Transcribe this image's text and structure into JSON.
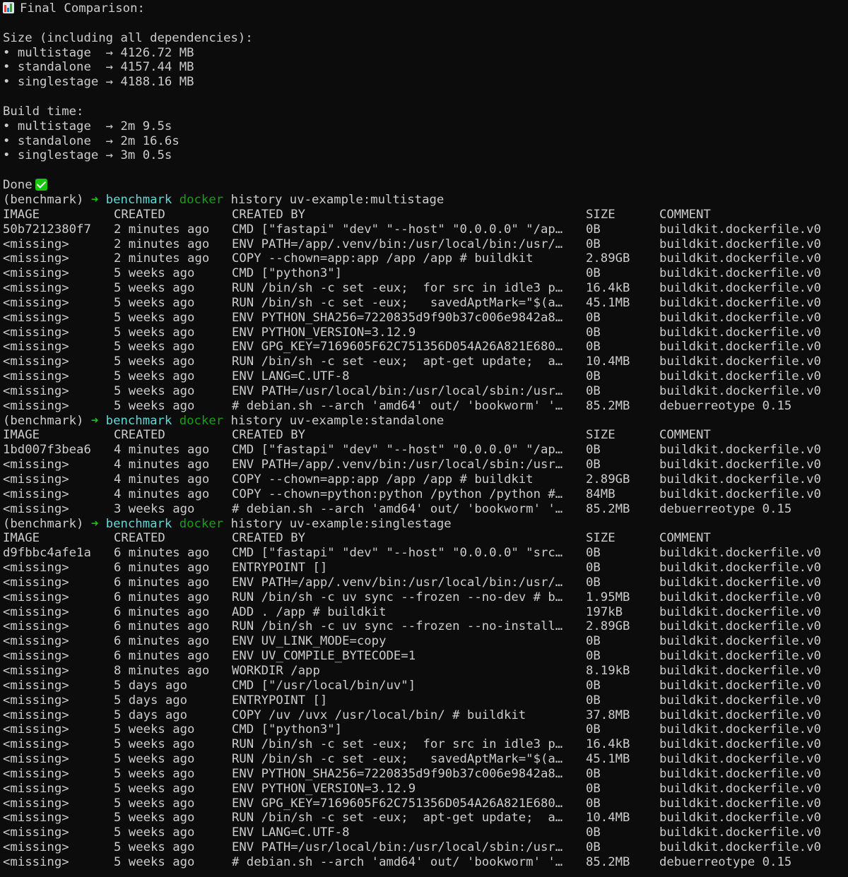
{
  "summary": {
    "title": "Final Comparison:",
    "size_heading": "Size (including all dependencies):",
    "size_items": [
      {
        "bullet": "•",
        "name": "multistage ",
        "arrow": "→",
        "value": "4126.72 MB"
      },
      {
        "bullet": "•",
        "name": "standalone ",
        "arrow": "→",
        "value": "4157.44 MB"
      },
      {
        "bullet": "•",
        "name": "singlestage",
        "arrow": "→",
        "value": "4188.16 MB"
      }
    ],
    "build_heading": "Build time:",
    "build_items": [
      {
        "bullet": "•",
        "name": "multistage ",
        "arrow": "→",
        "value": "2m 9.5s"
      },
      {
        "bullet": "•",
        "name": "standalone ",
        "arrow": "→",
        "value": "2m 16.6s"
      },
      {
        "bullet": "•",
        "name": "singlestage",
        "arrow": "→",
        "value": "3m 0.5s"
      }
    ],
    "done_label": "Done"
  },
  "prompt": {
    "env": "(benchmark)",
    "arrow": "➜",
    "dir": "benchmark",
    "cmd": "docker"
  },
  "headers": {
    "image": "IMAGE",
    "created": "CREATED",
    "created_by": "CREATED BY",
    "size": "SIZE",
    "comment": "COMMENT"
  },
  "histories": [
    {
      "args": "history uv-example:multistage",
      "rows": [
        {
          "image": "50b7212380f7",
          "created": "2 minutes ago",
          "by": "CMD [\"fastapi\" \"dev\" \"--host\" \"0.0.0.0\" \"/ap…",
          "size": "0B",
          "comment": "buildkit.dockerfile.v0"
        },
        {
          "image": "<missing>",
          "created": "2 minutes ago",
          "by": "ENV PATH=/app/.venv/bin:/usr/local/bin:/usr/…",
          "size": "0B",
          "comment": "buildkit.dockerfile.v0"
        },
        {
          "image": "<missing>",
          "created": "2 minutes ago",
          "by": "COPY --chown=app:app /app /app # buildkit",
          "size": "2.89GB",
          "comment": "buildkit.dockerfile.v0"
        },
        {
          "image": "<missing>",
          "created": "5 weeks ago",
          "by": "CMD [\"python3\"]",
          "size": "0B",
          "comment": "buildkit.dockerfile.v0"
        },
        {
          "image": "<missing>",
          "created": "5 weeks ago",
          "by": "RUN /bin/sh -c set -eux;  for src in idle3 p…",
          "size": "16.4kB",
          "comment": "buildkit.dockerfile.v0"
        },
        {
          "image": "<missing>",
          "created": "5 weeks ago",
          "by": "RUN /bin/sh -c set -eux;   savedAptMark=\"$(a…",
          "size": "45.1MB",
          "comment": "buildkit.dockerfile.v0"
        },
        {
          "image": "<missing>",
          "created": "5 weeks ago",
          "by": "ENV PYTHON_SHA256=7220835d9f90b37c006e9842a8…",
          "size": "0B",
          "comment": "buildkit.dockerfile.v0"
        },
        {
          "image": "<missing>",
          "created": "5 weeks ago",
          "by": "ENV PYTHON_VERSION=3.12.9",
          "size": "0B",
          "comment": "buildkit.dockerfile.v0"
        },
        {
          "image": "<missing>",
          "created": "5 weeks ago",
          "by": "ENV GPG_KEY=7169605F62C751356D054A26A821E680…",
          "size": "0B",
          "comment": "buildkit.dockerfile.v0"
        },
        {
          "image": "<missing>",
          "created": "5 weeks ago",
          "by": "RUN /bin/sh -c set -eux;  apt-get update;  a…",
          "size": "10.4MB",
          "comment": "buildkit.dockerfile.v0"
        },
        {
          "image": "<missing>",
          "created": "5 weeks ago",
          "by": "ENV LANG=C.UTF-8",
          "size": "0B",
          "comment": "buildkit.dockerfile.v0"
        },
        {
          "image": "<missing>",
          "created": "5 weeks ago",
          "by": "ENV PATH=/usr/local/bin:/usr/local/sbin:/usr…",
          "size": "0B",
          "comment": "buildkit.dockerfile.v0"
        },
        {
          "image": "<missing>",
          "created": "5 weeks ago",
          "by": "# debian.sh --arch 'amd64' out/ 'bookworm' '…",
          "size": "85.2MB",
          "comment": "debuerreotype 0.15"
        }
      ]
    },
    {
      "args": "history uv-example:standalone",
      "rows": [
        {
          "image": "1bd007f3bea6",
          "created": "4 minutes ago",
          "by": "CMD [\"fastapi\" \"dev\" \"--host\" \"0.0.0.0\" \"/ap…",
          "size": "0B",
          "comment": "buildkit.dockerfile.v0"
        },
        {
          "image": "<missing>",
          "created": "4 minutes ago",
          "by": "ENV PATH=/app/.venv/bin:/usr/local/sbin:/usr…",
          "size": "0B",
          "comment": "buildkit.dockerfile.v0"
        },
        {
          "image": "<missing>",
          "created": "4 minutes ago",
          "by": "COPY --chown=app:app /app /app # buildkit",
          "size": "2.89GB",
          "comment": "buildkit.dockerfile.v0"
        },
        {
          "image": "<missing>",
          "created": "4 minutes ago",
          "by": "COPY --chown=python:python /python /python #…",
          "size": "84MB",
          "comment": "buildkit.dockerfile.v0"
        },
        {
          "image": "<missing>",
          "created": "3 weeks ago",
          "by": "# debian.sh --arch 'amd64' out/ 'bookworm' '…",
          "size": "85.2MB",
          "comment": "debuerreotype 0.15"
        }
      ]
    },
    {
      "args": "history uv-example:singlestage",
      "rows": [
        {
          "image": "d9fbbc4afe1a",
          "created": "6 minutes ago",
          "by": "CMD [\"fastapi\" \"dev\" \"--host\" \"0.0.0.0\" \"src…",
          "size": "0B",
          "comment": "buildkit.dockerfile.v0"
        },
        {
          "image": "<missing>",
          "created": "6 minutes ago",
          "by": "ENTRYPOINT []",
          "size": "0B",
          "comment": "buildkit.dockerfile.v0"
        },
        {
          "image": "<missing>",
          "created": "6 minutes ago",
          "by": "ENV PATH=/app/.venv/bin:/usr/local/bin:/usr/…",
          "size": "0B",
          "comment": "buildkit.dockerfile.v0"
        },
        {
          "image": "<missing>",
          "created": "6 minutes ago",
          "by": "RUN /bin/sh -c uv sync --frozen --no-dev # b…",
          "size": "1.95MB",
          "comment": "buildkit.dockerfile.v0"
        },
        {
          "image": "<missing>",
          "created": "6 minutes ago",
          "by": "ADD . /app # buildkit",
          "size": "197kB",
          "comment": "buildkit.dockerfile.v0"
        },
        {
          "image": "<missing>",
          "created": "6 minutes ago",
          "by": "RUN /bin/sh -c uv sync --frozen --no-install…",
          "size": "2.89GB",
          "comment": "buildkit.dockerfile.v0"
        },
        {
          "image": "<missing>",
          "created": "6 minutes ago",
          "by": "ENV UV_LINK_MODE=copy",
          "size": "0B",
          "comment": "buildkit.dockerfile.v0"
        },
        {
          "image": "<missing>",
          "created": "6 minutes ago",
          "by": "ENV UV_COMPILE_BYTECODE=1",
          "size": "0B",
          "comment": "buildkit.dockerfile.v0"
        },
        {
          "image": "<missing>",
          "created": "8 minutes ago",
          "by": "WORKDIR /app",
          "size": "8.19kB",
          "comment": "buildkit.dockerfile.v0"
        },
        {
          "image": "<missing>",
          "created": "5 days ago",
          "by": "CMD [\"/usr/local/bin/uv\"]",
          "size": "0B",
          "comment": "buildkit.dockerfile.v0"
        },
        {
          "image": "<missing>",
          "created": "5 days ago",
          "by": "ENTRYPOINT []",
          "size": "0B",
          "comment": "buildkit.dockerfile.v0"
        },
        {
          "image": "<missing>",
          "created": "5 days ago",
          "by": "COPY /uv /uvx /usr/local/bin/ # buildkit",
          "size": "37.8MB",
          "comment": "buildkit.dockerfile.v0"
        },
        {
          "image": "<missing>",
          "created": "5 weeks ago",
          "by": "CMD [\"python3\"]",
          "size": "0B",
          "comment": "buildkit.dockerfile.v0"
        },
        {
          "image": "<missing>",
          "created": "5 weeks ago",
          "by": "RUN /bin/sh -c set -eux;  for src in idle3 p…",
          "size": "16.4kB",
          "comment": "buildkit.dockerfile.v0"
        },
        {
          "image": "<missing>",
          "created": "5 weeks ago",
          "by": "RUN /bin/sh -c set -eux;   savedAptMark=\"$(a…",
          "size": "45.1MB",
          "comment": "buildkit.dockerfile.v0"
        },
        {
          "image": "<missing>",
          "created": "5 weeks ago",
          "by": "ENV PYTHON_SHA256=7220835d9f90b37c006e9842a8…",
          "size": "0B",
          "comment": "buildkit.dockerfile.v0"
        },
        {
          "image": "<missing>",
          "created": "5 weeks ago",
          "by": "ENV PYTHON_VERSION=3.12.9",
          "size": "0B",
          "comment": "buildkit.dockerfile.v0"
        },
        {
          "image": "<missing>",
          "created": "5 weeks ago",
          "by": "ENV GPG_KEY=7169605F62C751356D054A26A821E680…",
          "size": "0B",
          "comment": "buildkit.dockerfile.v0"
        },
        {
          "image": "<missing>",
          "created": "5 weeks ago",
          "by": "RUN /bin/sh -c set -eux;  apt-get update;  a…",
          "size": "10.4MB",
          "comment": "buildkit.dockerfile.v0"
        },
        {
          "image": "<missing>",
          "created": "5 weeks ago",
          "by": "ENV LANG=C.UTF-8",
          "size": "0B",
          "comment": "buildkit.dockerfile.v0"
        },
        {
          "image": "<missing>",
          "created": "5 weeks ago",
          "by": "ENV PATH=/usr/local/bin:/usr/local/sbin:/usr…",
          "size": "0B",
          "comment": "buildkit.dockerfile.v0"
        },
        {
          "image": "<missing>",
          "created": "5 weeks ago",
          "by": "# debian.sh --arch 'amd64' out/ 'bookworm' '…",
          "size": "85.2MB",
          "comment": "debuerreotype 0.15"
        }
      ]
    }
  ],
  "colors": {
    "background": "#0c0c0c",
    "foreground": "#cccccc",
    "prompt_arrow": "#16c60c",
    "prompt_dir": "#61d6d6",
    "prompt_cmd": "#13a10e",
    "check_badge": "#16c60c"
  },
  "icons": {
    "title_icon": "bar-chart-icon",
    "done_icon": "check-mark-icon"
  }
}
